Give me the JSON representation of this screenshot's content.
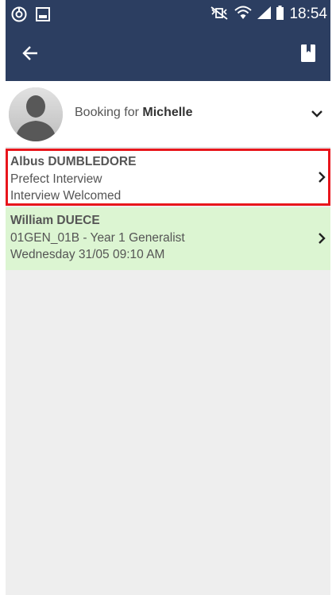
{
  "status_bar": {
    "time": "18:54",
    "icons": [
      "settings-circle-icon",
      "image-icon",
      "mute-vibrate-icon",
      "wifi-icon",
      "signal-icon",
      "battery-icon"
    ]
  },
  "app_bar": {
    "back_icon": "arrow-left-icon",
    "action_icon": "book-icon"
  },
  "booking": {
    "prefix": "Booking for ",
    "name": "Michelle"
  },
  "list": [
    {
      "name": "Albus DUMBLEDORE",
      "line2": "Prefect Interview",
      "line3": "Interview Welcomed"
    },
    {
      "name": "William DUECE",
      "line2": "01GEN_01B - Year 1 Generalist",
      "line3": "Wednesday 31/05 09:10 AM"
    }
  ],
  "colors": {
    "bar": "#2c3e61",
    "highlight_border": "#e8161c",
    "booked_row": "#dcf5d2",
    "background": "#eeeeee"
  }
}
